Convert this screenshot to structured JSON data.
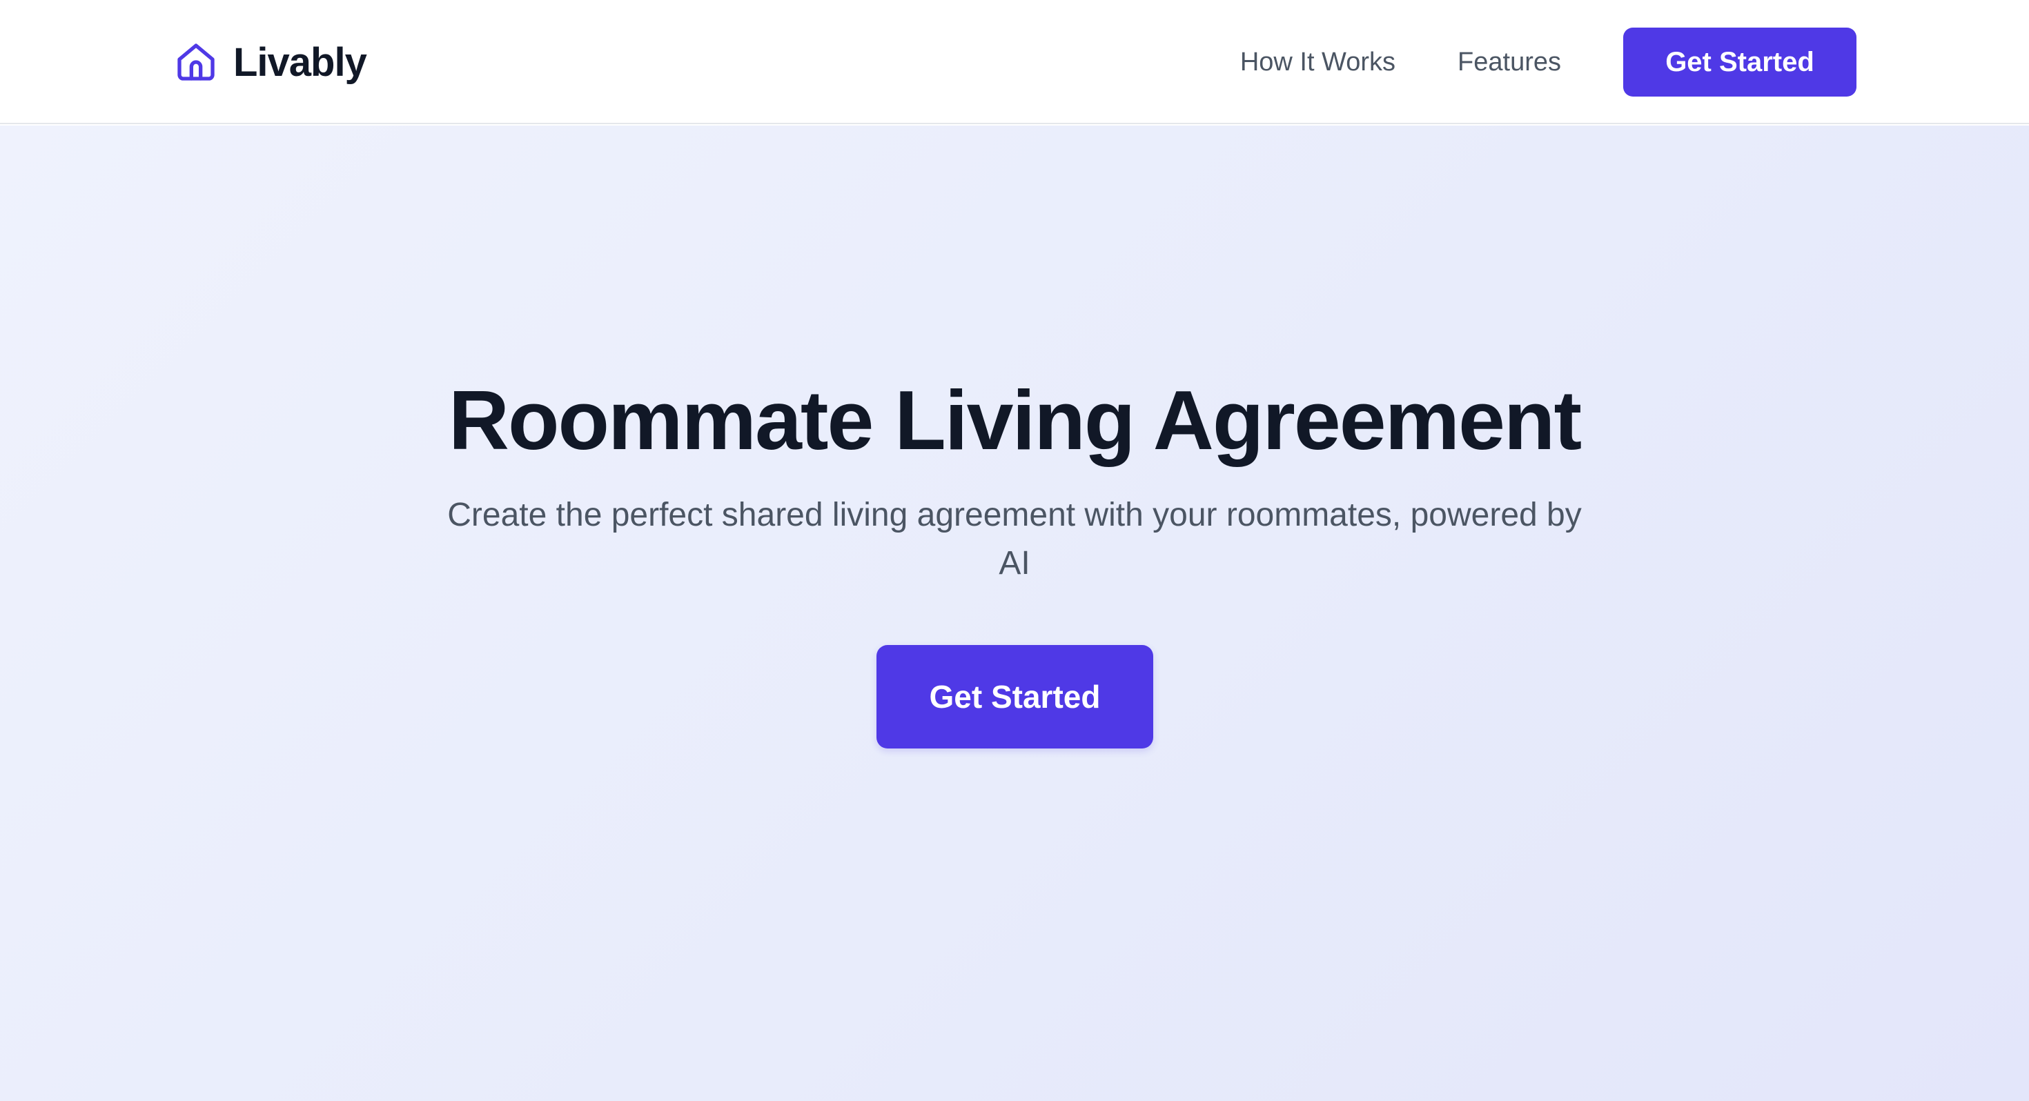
{
  "brand": {
    "name": "Livably",
    "icon": "home-icon",
    "accent_color": "#4f39e6"
  },
  "nav": {
    "links": [
      {
        "label": "How It Works"
      },
      {
        "label": "Features"
      }
    ],
    "cta_label": "Get Started"
  },
  "hero": {
    "title": "Roommate Living Agreement",
    "subtitle": "Create the perfect shared living agreement with your roommates, powered by AI",
    "cta_label": "Get Started"
  },
  "colors": {
    "primary": "#4f39e6",
    "heading": "#111827",
    "body_text": "#4b5563",
    "hero_background": "#eceffc"
  }
}
